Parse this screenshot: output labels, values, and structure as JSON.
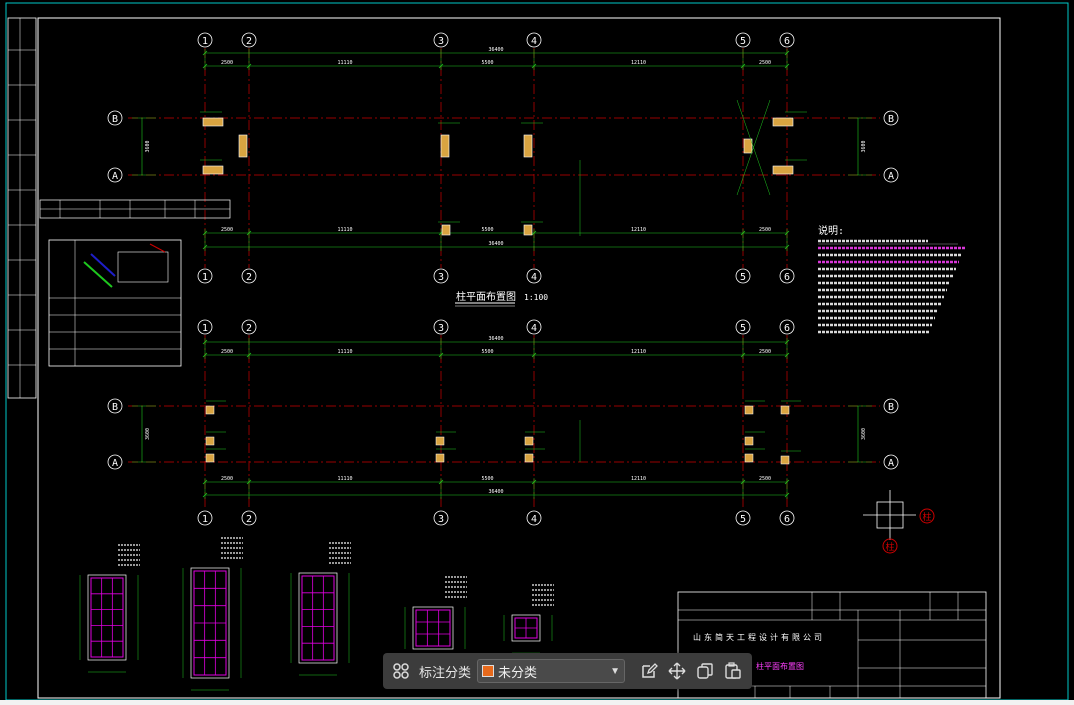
{
  "viewer": {
    "toolbar": {
      "label": "标注分类",
      "select_value": "未分类",
      "select_color": "#e86a1c"
    },
    "icons": [
      "grid-icon",
      "edit-icon",
      "move-icon",
      "copy-icon",
      "paste-icon",
      "caret-down-icon"
    ]
  },
  "colors": {
    "grid_line": "#cc0000",
    "dimension": "#1ec81e",
    "text": "#ffffff",
    "frame": "#00c8c8",
    "column_fill": "#d9a441",
    "rebar": "#e000e0",
    "note_title": "#ff40ff"
  },
  "plan_top": {
    "axis_labels_x": [
      "1",
      "2",
      "3",
      "4",
      "5",
      "6"
    ],
    "axis_labels_y": [
      "B",
      "A"
    ],
    "dims_top": [
      "2500",
      "11110",
      "5500",
      "12110",
      "2500"
    ],
    "overall": "36400",
    "dims_side": [
      "3600"
    ],
    "title": "柱平面布置图",
    "scale": "1:100"
  },
  "plan_bottom": {
    "axis_labels_x": [
      "1",
      "2",
      "3",
      "4",
      "5",
      "6"
    ],
    "axis_labels_y": [
      "B",
      "A"
    ],
    "dims_top": [
      "2500",
      "11110",
      "5500",
      "12110",
      "2500"
    ],
    "overall": "36400"
  },
  "notes": {
    "title": "说明:"
  },
  "titleblock": {
    "company": "山东简天工程设计有限公司",
    "drawing_name": "柱平面布置图"
  },
  "crosshair_labels": [
    "柱",
    "柱"
  ]
}
